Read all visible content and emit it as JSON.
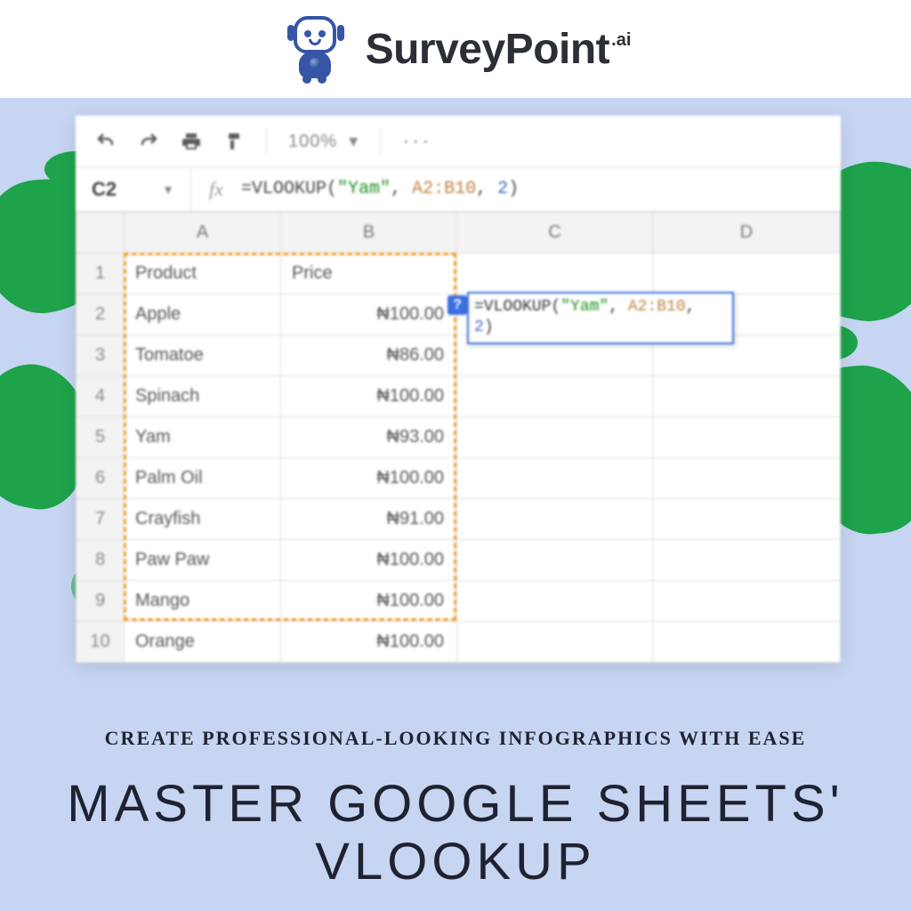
{
  "brand": {
    "name": "SurveyPoint",
    "suffix": ".ai"
  },
  "toolbar": {
    "zoom": "100%",
    "more": "···"
  },
  "formula_bar": {
    "cell_ref": "C2",
    "fx": "fx",
    "prefix": "=VLOOKUP(",
    "arg_str": "\"Yam\"",
    "sep1": ", ",
    "arg_range": "A2:B10",
    "sep2": ", ",
    "arg_num": "2",
    "suffix": ")"
  },
  "columns": {
    "A": "A",
    "B": "B",
    "C": "C",
    "D": "D"
  },
  "headers": {
    "product": "Product",
    "price": "Price"
  },
  "rows": [
    {
      "n": "1"
    },
    {
      "n": "2",
      "a": "Apple",
      "b": "₦100.00"
    },
    {
      "n": "3",
      "a": "Tomatoe",
      "b": "₦86.00"
    },
    {
      "n": "4",
      "a": "Spinach",
      "b": "₦100.00"
    },
    {
      "n": "5",
      "a": "Yam",
      "b": "₦93.00"
    },
    {
      "n": "6",
      "a": "Palm Oil",
      "b": "₦100.00"
    },
    {
      "n": "7",
      "a": "Crayfish",
      "b": "₦91.00"
    },
    {
      "n": "8",
      "a": "Paw Paw",
      "b": "₦100.00"
    },
    {
      "n": "9",
      "a": "Mango",
      "b": "₦100.00"
    },
    {
      "n": "10",
      "a": "Orange",
      "b": "₦100.00"
    }
  ],
  "active_cell": {
    "hint": "?",
    "prefix": "=VLOOKUP(",
    "arg_str": "\"Yam\"",
    "sep1": ", ",
    "arg_range": "A2:B10",
    "sep2": ", ",
    "arg_num": "2",
    "suffix": ")"
  },
  "captions": {
    "small": "CREATE PROFESSIONAL-LOOKING INFOGRAPHICS WITH EASE",
    "big": "MASTER GOOGLE SHEETS' VLOOKUP"
  }
}
